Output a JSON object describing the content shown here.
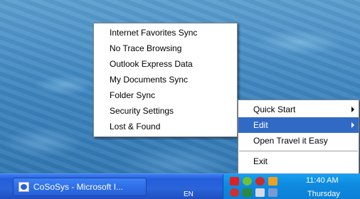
{
  "submenu": {
    "items": [
      "Internet Favorites Sync",
      "No Trace Browsing",
      "Outlook Express Data",
      "My Documents Sync",
      "Folder Sync",
      "Security Settings",
      "Lost & Found"
    ]
  },
  "main_menu": {
    "quick_start": "Quick Start",
    "edit": "Edit",
    "open": "Open Travel it Easy",
    "exit": "Exit"
  },
  "taskbar": {
    "window_button": "CoSoSys - Microsoft I...",
    "language": "EN",
    "clock": "11:40 AM",
    "day": "Thursday"
  },
  "colors": {
    "highlight": "#316ac5",
    "taskbar": "#245edb",
    "tray": "#0f8be0"
  }
}
